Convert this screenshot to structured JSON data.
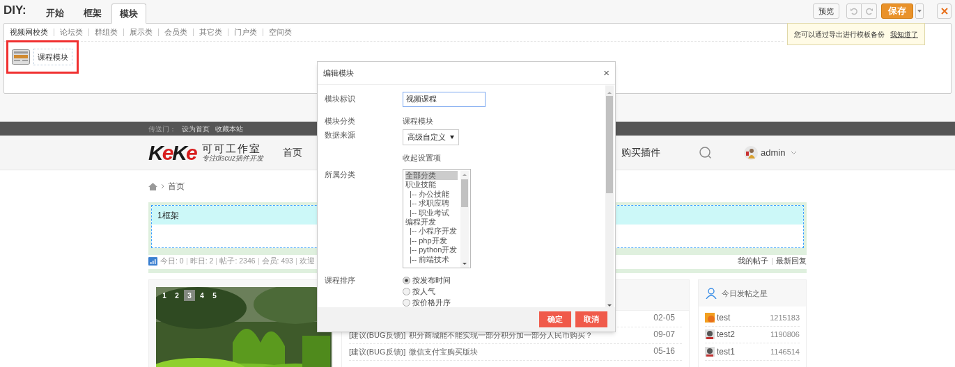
{
  "diy": {
    "label": "DIY:",
    "tabs": [
      {
        "label": "开始",
        "selected": false
      },
      {
        "label": "框架",
        "selected": false
      },
      {
        "label": "模块",
        "selected": true
      }
    ],
    "categories": [
      {
        "label": "视频网校类",
        "selected": true
      },
      {
        "label": "论坛类",
        "selected": false
      },
      {
        "label": "群组类",
        "selected": false
      },
      {
        "label": "展示类",
        "selected": false
      },
      {
        "label": "会员类",
        "selected": false
      },
      {
        "label": "其它类",
        "selected": false
      },
      {
        "label": "门户类",
        "selected": false
      },
      {
        "label": "空间类",
        "selected": false
      }
    ],
    "modules": [
      {
        "label": "课程模块",
        "highlighted": true
      }
    ],
    "preview_button": "预览",
    "save_button": "保存",
    "tooltip": {
      "text": "您可以通过导出进行模板备份",
      "link": "我知道了"
    }
  },
  "site": {
    "topbar": {
      "label": "传送门：",
      "links": [
        "设为首页",
        "收藏本站"
      ]
    },
    "logo": {
      "brand": "KeKe",
      "name": "可可工作室",
      "slogan": "专注discuz插件开发"
    },
    "nav": [
      "首页",
      "购买插件"
    ],
    "user": "admin",
    "breadcrumb": "首页",
    "frame_title": "1框架",
    "stats": [
      "今日: 0",
      "昨日: 2",
      "帖子: 2346",
      "会员: 493",
      "欢迎"
    ],
    "links": [
      "我的帖子",
      "最新回复"
    ],
    "slides": [
      {
        "label": "1",
        "selected": false
      },
      {
        "label": "2",
        "selected": false
      },
      {
        "label": "3",
        "selected": true
      },
      {
        "label": "4",
        "selected": false
      },
      {
        "label": "5",
        "selected": false
      }
    ],
    "threads": [
      {
        "date": "02-05"
      },
      {
        "tag": "[建议(BUG反馈)]",
        "title": "积分商城能不能实现一部分积分加一部分人民币购买？",
        "date": "09-07"
      },
      {
        "tag": "[建议(BUG反馈)]",
        "title": "微信支付宝购买版块",
        "date": "05-16"
      }
    ],
    "stars": {
      "title": "今日发帖之星",
      "rows": [
        {
          "name": "test",
          "count": "1215183"
        },
        {
          "name": "test2",
          "count": "1190806",
          "kind": "cartoon"
        },
        {
          "name": "test1",
          "count": "1146514",
          "kind": "cartoon"
        }
      ]
    }
  },
  "dialog": {
    "title": "编辑模块",
    "close": "×",
    "fields": [
      {
        "kind": "input",
        "label": "模块标识",
        "value": "视频课程"
      },
      {
        "kind": "text",
        "label": "模块分类",
        "value": "课程模块"
      },
      {
        "kind": "select",
        "label": "数据来源",
        "value": "高级自定义"
      },
      {
        "kind": "link",
        "value": "收起设置项"
      },
      {
        "kind": "listbox",
        "label": "所属分类",
        "items": [
          {
            "label": "全部分类",
            "selected": true
          },
          {
            "label": "职业技能",
            "selected": false,
            "children": [
              {
                "label": "|-- 办公技能",
                "selected": false
              },
              {
                "label": "|-- 求职应聘",
                "selected": false
              },
              {
                "label": "|-- 职业考试",
                "selected": false
              }
            ]
          },
          {
            "label": "编程开发",
            "selected": false,
            "children": [
              {
                "label": "|-- 小程序开发",
                "selected": false
              },
              {
                "label": "|-- php开发",
                "selected": false
              },
              {
                "label": "|-- python开发",
                "selected": false
              },
              {
                "label": "|-- 前端技术",
                "selected": false
              }
            ]
          }
        ]
      },
      {
        "kind": "radio",
        "label": "课程排序",
        "options": [
          {
            "label": "按发布时间",
            "selected": true
          },
          {
            "label": "按人气",
            "selected": false
          },
          {
            "label": "按价格升序",
            "selected": false
          }
        ]
      }
    ],
    "buttons": [
      "确定",
      "取消"
    ]
  }
}
